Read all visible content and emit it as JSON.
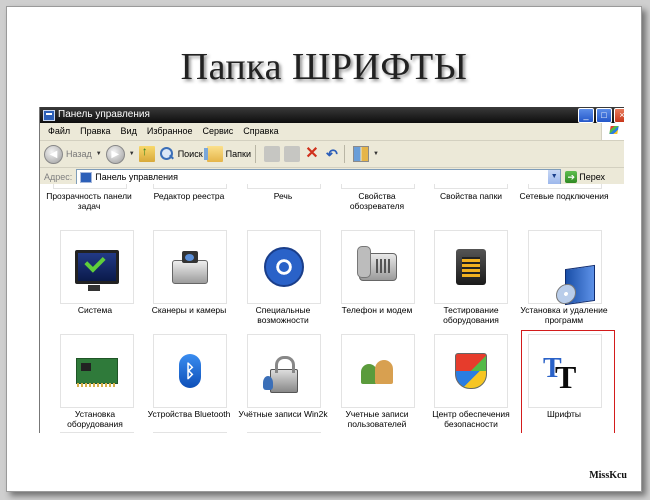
{
  "slide": {
    "title": "Папка ШРИФТЫ",
    "credit": "MissKcu"
  },
  "window": {
    "title": "Панель управления",
    "controls": {
      "minimize": "_",
      "maximize": "□",
      "close": "×"
    }
  },
  "menu": [
    "Файл",
    "Правка",
    "Вид",
    "Избранное",
    "Сервис",
    "Справка"
  ],
  "toolbar": {
    "back_label": "Назад",
    "search_label": "Поиск",
    "folders_label": "Папки"
  },
  "address": {
    "label": "Адрес:",
    "value": "Панель управления",
    "go_label": "Перех"
  },
  "items_row0": [
    "Прозрачность панели задач",
    "Редактор реестра",
    "Речь",
    "Свойства обозревателя",
    "Свойства папки",
    "Сетевые подключения"
  ],
  "items_row1": [
    {
      "label": "Система",
      "icon": "monitor-icon"
    },
    {
      "label": "Сканеры и камеры",
      "icon": "scanner-icon"
    },
    {
      "label": "Специальные возможности",
      "icon": "accessibility-icon"
    },
    {
      "label": "Телефон и модем",
      "icon": "phone-icon"
    },
    {
      "label": "Тестирование оборудования",
      "icon": "hardware-test-icon"
    },
    {
      "label": "Установка и удаление программ",
      "icon": "install-programs-icon"
    }
  ],
  "items_row2": [
    {
      "label": "Установка оборудования",
      "icon": "hardware-card-icon"
    },
    {
      "label": "Устройства Bluetooth",
      "icon": "bluetooth-icon"
    },
    {
      "label": "Учётные записи Win2k",
      "icon": "lock-users-icon"
    },
    {
      "label": "Учетные записи пользователей",
      "icon": "users-icon"
    },
    {
      "label": "Центр обеспечения безопасности",
      "icon": "security-shield-icon"
    },
    {
      "label": "Шрифты",
      "icon": "fonts-icon"
    }
  ],
  "colors": {
    "highlight": "#d31b1b",
    "titlebar": "#0d0d0d",
    "chrome": "#ece9d8"
  }
}
